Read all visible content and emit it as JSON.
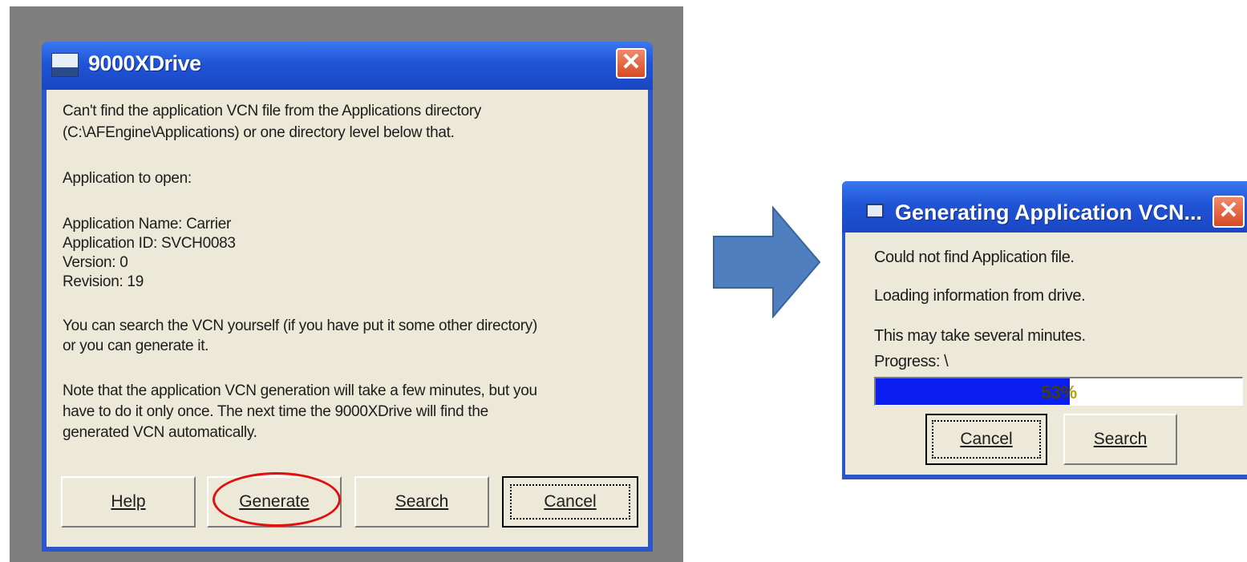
{
  "colors": {
    "titlebar_blue": "#1f54d6",
    "dialog_face": "#ece9d8",
    "close_red": "#d84a25",
    "progress_blue": "#0a1ef0",
    "highlight_red": "#e11010",
    "arrow_blue": "#4f7fbf"
  },
  "dialog_main": {
    "title": "9000XDrive",
    "close_glyph": "✕",
    "message": {
      "line1": "Can't find the application VCN file from the Applications directory",
      "line2": "(C:\\AFEngine\\Applications) or one directory level below that.",
      "open_heading": "Application to open:",
      "app_name": "Application Name: Carrier",
      "app_id": "Application ID: SVCH0083",
      "version": "Version: 0",
      "revision": "Revision: 19",
      "search_note_1": "You can search the VCN yourself (if you have put it some other directory)",
      "search_note_2": "or you can generate it.",
      "gen_note_1": "Note that the application VCN generation will take a few minutes, but you",
      "gen_note_2": "have to do it only once. The next time the 9000XDrive will find the",
      "gen_note_3": "generated VCN automatically."
    },
    "buttons": {
      "help": "Help",
      "generate": "Generate",
      "search": "Search",
      "cancel": "Cancel"
    },
    "icons": {
      "app": "application-icon",
      "close": "close-icon"
    }
  },
  "arrow": {
    "icon": "right-arrow-icon"
  },
  "dialog_progress": {
    "title": "Generating Application VCN...",
    "close_glyph": "✕",
    "line1": "Could not find Application file.",
    "line2": "Loading information from drive.",
    "line3": "This may take several minutes.",
    "progress_label": "Progress: \\",
    "progress_percent": 53,
    "progress_text": "53%",
    "buttons": {
      "cancel": "Cancel",
      "search": "Search"
    }
  }
}
